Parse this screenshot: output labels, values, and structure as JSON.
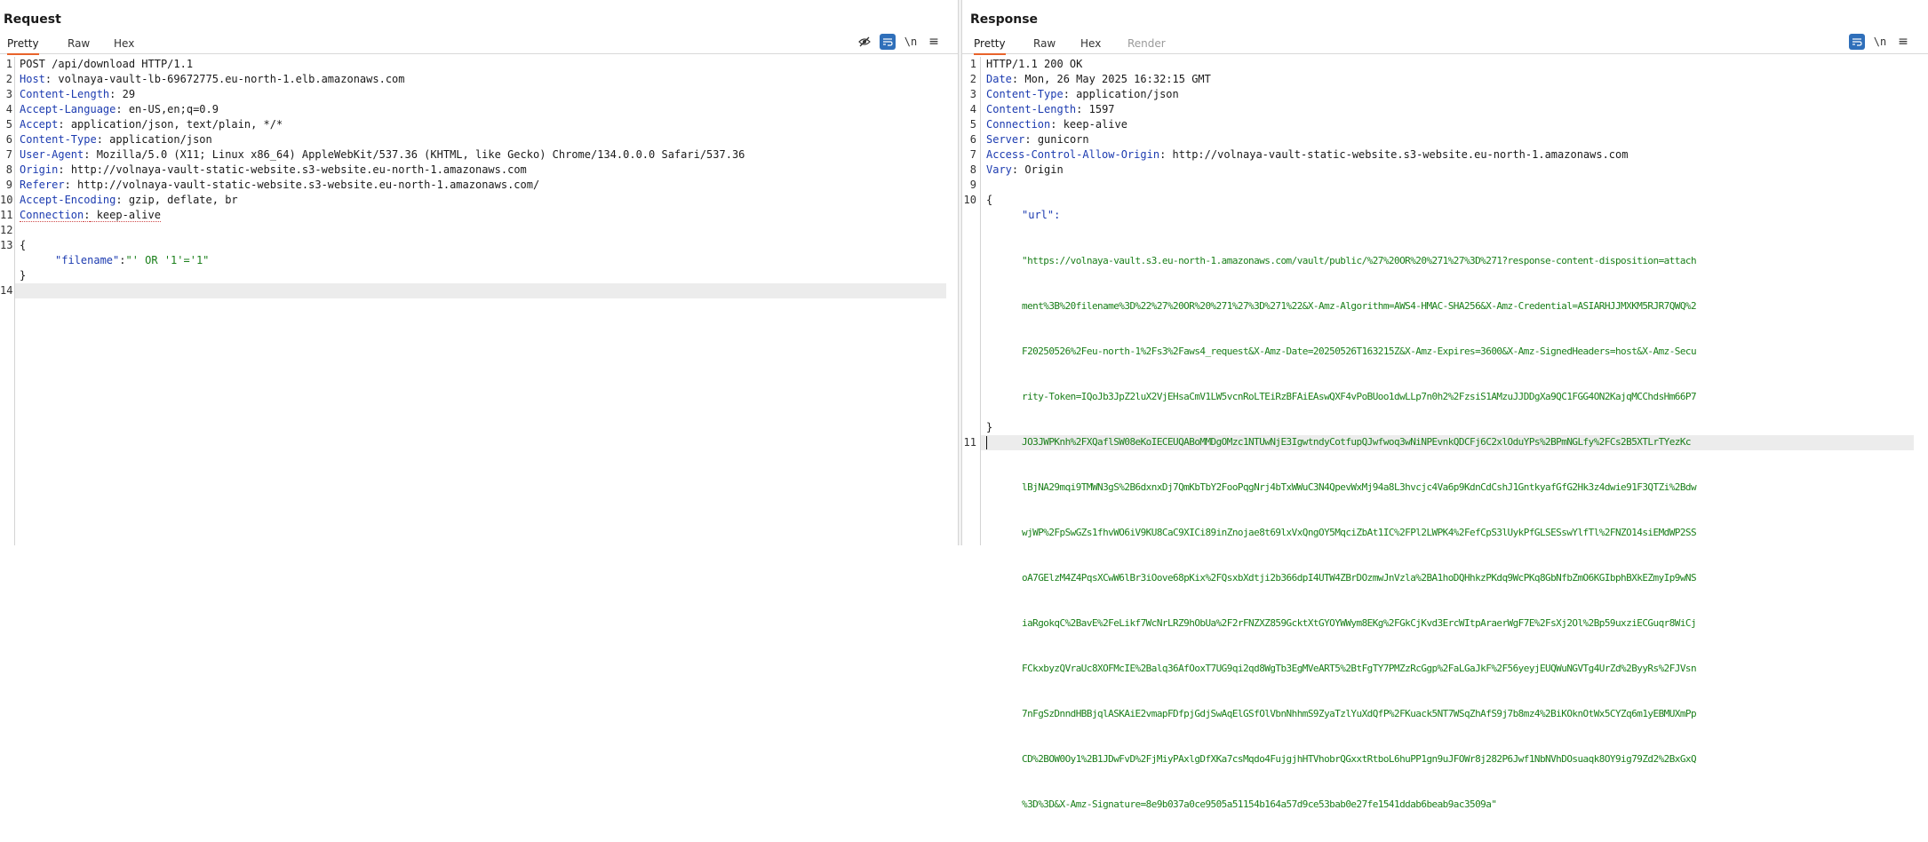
{
  "layout_buttons": [
    "split-horizontal",
    "split-vertical",
    "tabbed"
  ],
  "request": {
    "title": "Request",
    "tabs": [
      "Pretty",
      "Raw",
      "Hex"
    ],
    "active_tab": "Pretty",
    "tool_icons": [
      "hide-eye-icon",
      "wrap-icon",
      "newline-icon",
      "menu-icon"
    ],
    "newline_label": "\\n",
    "line_numbers": [
      "1",
      "2",
      "3",
      "4",
      "5",
      "6",
      "7",
      "8",
      "9",
      "10",
      "11",
      "12",
      "13",
      "",
      "",
      "14"
    ],
    "lines": {
      "l1": "POST /api/download HTTP/1.1",
      "l2_name": "Host",
      "l2_value": " volnaya-vault-lb-69672775.eu-north-1.elb.amazonaws.com",
      "l3_name": "Content-Length",
      "l3_value": " 29",
      "l4_name": "Accept-Language",
      "l4_value": " en-US,en;q=0.9",
      "l5_name": "Accept",
      "l5_value": " application/json, text/plain, */*",
      "l6_name": "Content-Type",
      "l6_value": " application/json",
      "l7_name": "User-Agent",
      "l7_value": " Mozilla/5.0 (X11; Linux x86_64) AppleWebKit/537.36 (KHTML, like Gecko) Chrome/134.0.0.0 Safari/537.36",
      "l8_name": "Origin",
      "l8_value": " http://volnaya-vault-static-website.s3-website.eu-north-1.amazonaws.com",
      "l9_name": "Referer",
      "l9_value": " http://volnaya-vault-static-website.s3-website.eu-north-1.amazonaws.com/",
      "l10_name": "Accept-Encoding",
      "l10_value": " gzip, deflate, br",
      "l11_name": "Connection",
      "l11_value": " keep-alive",
      "l13": "{",
      "body_key": "\"filename\"",
      "body_colon": ":",
      "body_value": "\"' OR '1'='1\"",
      "close": "}"
    }
  },
  "response": {
    "title": "Response",
    "tabs": [
      "Pretty",
      "Raw",
      "Hex",
      "Render"
    ],
    "active_tab": "Pretty",
    "tool_icons": [
      "wrap-icon",
      "newline-icon",
      "menu-icon"
    ],
    "newline_label": "\\n",
    "line_numbers": [
      "1",
      "2",
      "3",
      "4",
      "5",
      "6",
      "7",
      "8",
      "9",
      "10",
      "11"
    ],
    "lines": {
      "l1": "HTTP/1.1 200 OK",
      "l2_name": "Date",
      "l2_value": " Mon, 26 May 2025 16:32:15 GMT",
      "l3_name": "Content-Type",
      "l3_value": " application/json",
      "l4_name": "Content-Length",
      "l4_value": " 1597",
      "l5_name": "Connection",
      "l5_value": " keep-alive",
      "l6_name": "Server",
      "l6_value": " gunicorn",
      "l7_name": "Access-Control-Allow-Origin",
      "l7_value": " http://volnaya-vault-static-website.s3-website.eu-north-1.amazonaws.com",
      "l8_name": "Vary",
      "l8_value": " Origin",
      "open": "{",
      "url_key": "\"url\":",
      "url_lines": [
        "\"https://volnaya-vault.s3.eu-north-1.amazonaws.com/vault/public/%27%20OR%20%271%27%3D%271?response-content-disposition=attach",
        "ment%3B%20filename%3D%22%27%20OR%20%271%27%3D%271%22&X-Amz-Algorithm=AWS4-HMAC-SHA256&X-Amz-Credential=ASIARHJJMXKM5RJR7QWQ%2",
        "F20250526%2Feu-north-1%2Fs3%2Faws4_request&X-Amz-Date=20250526T163215Z&X-Amz-Expires=3600&X-Amz-SignedHeaders=host&X-Amz-Secu",
        "rity-Token=IQoJb3JpZ2luX2VjEHsaCmV1LW5vcnRoLTEiRzBFAiEAswQXF4vPoBUoo1dwLLp7n0h2%2FzsiS1AMzuJJDDgXa9QC1FGG4ON2KajqMCChdsHm66P7",
        "JO3JWPKnh%2FXQaflSW08eKoIECEUQABoMMDgOMzc1NTUwNjE3IgwtndyCotfupQJwfwoq3wNiNPEvnkQDCFj6C2xlOduYPs%2BPmNGLfy%2FCs2B5XTLrTYezKc",
        "lBjNA29mqi9TMWN3gS%2B6dxnxDj7QmKbTbY2FooPqgNrj4bTxWWuC3N4QpevWxMj94a8L3hvcjc4Va6p9KdnCdCshJ1GntkyafGfG2Hk3z4dwie91F3QTZi%2Bdw",
        "wjWP%2FpSwGZs1fhvWO6iV9KU8CaC9XICi89inZnojae8t69lxVxQngOY5MqciZbAt1IC%2FPl2LWPK4%2FefCpS3lUykPfGLSESswYlfTl%2FNZO14siEMdWP2SS",
        "oA7GElzM4Z4PqsXCwW6lBr3iOove68pKix%2FQsxbXdtji2b366dpI4UTW4ZBrDOzmwJnVzla%2BA1hoDQHhkzPKdq9WcPKq8GbNfbZmO6KGIbphBXkEZmyIp9wNS",
        "iaRgokqC%2BavE%2FeLikf7WcNrLRZ9hObUa%2F2rFNZXZ859GcktXtGYOYWWym8EKg%2FGkCjKvd3ErcWItpAraerWgF7E%2FsXj2Ol%2Bp59uxziECGuqr8WiCj",
        "FCkxbyzQVraUc8XOFMcIE%2Balq36AfOoxT7UG9qi2qd8WgTb3EgMVeART5%2BtFgTY7PMZzRcGgp%2FaLGaJkF%2F56yeyjEUQWuNGVTg4UrZd%2ByyRs%2FJVsn",
        "7nFgSzDnndHBBjqlASKAiE2vmapFDfpjGdjSwAqElGSfOlVbnNhhmS9ZyaTzlYuXdQfP%2FKuack5NT7WSqZhAfS9j7b8mz4%2BiKOknOtWx5CYZq6m1yEBMUXmPp",
        "CD%2BOW0Oy1%2B1JDwFvD%2FjMiyPAxlgDfXKa7csMqdo4FujgjhHTVhobrQGxxtRtboL6huPP1gn9uJFOWr8j282P6Jwf1NbNVhDOsuaqk8OY9ig79Zd2%2BxGxQ",
        "%3D%3D&X-Amz-Signature=8e9b037a0ce9505a51154b164a57d9ce53bab0e27fe1541ddab6beab9ac3509a\""
      ],
      "close": "}"
    }
  }
}
